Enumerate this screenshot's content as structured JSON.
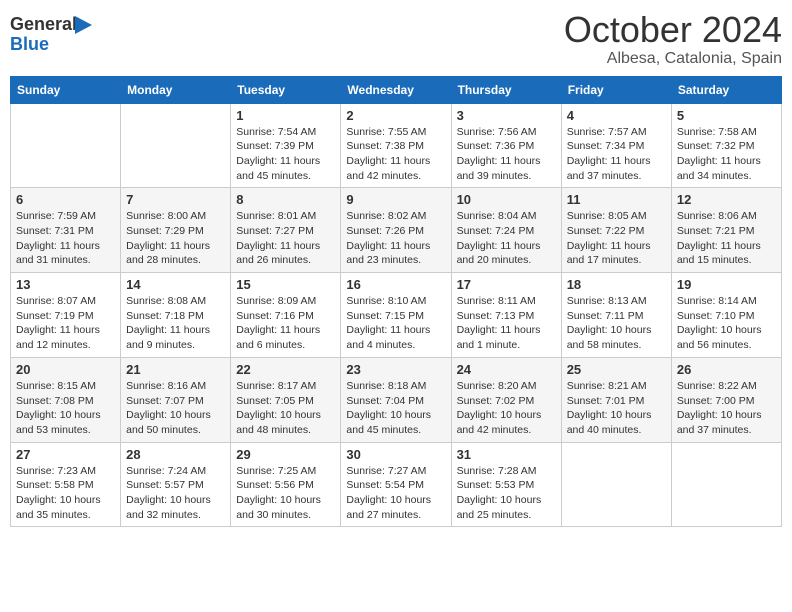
{
  "header": {
    "logo_general": "General",
    "logo_blue": "Blue",
    "month_title": "October 2024",
    "subtitle": "Albesa, Catalonia, Spain"
  },
  "weekdays": [
    "Sunday",
    "Monday",
    "Tuesday",
    "Wednesday",
    "Thursday",
    "Friday",
    "Saturday"
  ],
  "weeks": [
    [
      {
        "day": "",
        "sunrise": "",
        "sunset": "",
        "daylight": ""
      },
      {
        "day": "",
        "sunrise": "",
        "sunset": "",
        "daylight": ""
      },
      {
        "day": "1",
        "sunrise": "Sunrise: 7:54 AM",
        "sunset": "Sunset: 7:39 PM",
        "daylight": "Daylight: 11 hours and 45 minutes."
      },
      {
        "day": "2",
        "sunrise": "Sunrise: 7:55 AM",
        "sunset": "Sunset: 7:38 PM",
        "daylight": "Daylight: 11 hours and 42 minutes."
      },
      {
        "day": "3",
        "sunrise": "Sunrise: 7:56 AM",
        "sunset": "Sunset: 7:36 PM",
        "daylight": "Daylight: 11 hours and 39 minutes."
      },
      {
        "day": "4",
        "sunrise": "Sunrise: 7:57 AM",
        "sunset": "Sunset: 7:34 PM",
        "daylight": "Daylight: 11 hours and 37 minutes."
      },
      {
        "day": "5",
        "sunrise": "Sunrise: 7:58 AM",
        "sunset": "Sunset: 7:32 PM",
        "daylight": "Daylight: 11 hours and 34 minutes."
      }
    ],
    [
      {
        "day": "6",
        "sunrise": "Sunrise: 7:59 AM",
        "sunset": "Sunset: 7:31 PM",
        "daylight": "Daylight: 11 hours and 31 minutes."
      },
      {
        "day": "7",
        "sunrise": "Sunrise: 8:00 AM",
        "sunset": "Sunset: 7:29 PM",
        "daylight": "Daylight: 11 hours and 28 minutes."
      },
      {
        "day": "8",
        "sunrise": "Sunrise: 8:01 AM",
        "sunset": "Sunset: 7:27 PM",
        "daylight": "Daylight: 11 hours and 26 minutes."
      },
      {
        "day": "9",
        "sunrise": "Sunrise: 8:02 AM",
        "sunset": "Sunset: 7:26 PM",
        "daylight": "Daylight: 11 hours and 23 minutes."
      },
      {
        "day": "10",
        "sunrise": "Sunrise: 8:04 AM",
        "sunset": "Sunset: 7:24 PM",
        "daylight": "Daylight: 11 hours and 20 minutes."
      },
      {
        "day": "11",
        "sunrise": "Sunrise: 8:05 AM",
        "sunset": "Sunset: 7:22 PM",
        "daylight": "Daylight: 11 hours and 17 minutes."
      },
      {
        "day": "12",
        "sunrise": "Sunrise: 8:06 AM",
        "sunset": "Sunset: 7:21 PM",
        "daylight": "Daylight: 11 hours and 15 minutes."
      }
    ],
    [
      {
        "day": "13",
        "sunrise": "Sunrise: 8:07 AM",
        "sunset": "Sunset: 7:19 PM",
        "daylight": "Daylight: 11 hours and 12 minutes."
      },
      {
        "day": "14",
        "sunrise": "Sunrise: 8:08 AM",
        "sunset": "Sunset: 7:18 PM",
        "daylight": "Daylight: 11 hours and 9 minutes."
      },
      {
        "day": "15",
        "sunrise": "Sunrise: 8:09 AM",
        "sunset": "Sunset: 7:16 PM",
        "daylight": "Daylight: 11 hours and 6 minutes."
      },
      {
        "day": "16",
        "sunrise": "Sunrise: 8:10 AM",
        "sunset": "Sunset: 7:15 PM",
        "daylight": "Daylight: 11 hours and 4 minutes."
      },
      {
        "day": "17",
        "sunrise": "Sunrise: 8:11 AM",
        "sunset": "Sunset: 7:13 PM",
        "daylight": "Daylight: 11 hours and 1 minute."
      },
      {
        "day": "18",
        "sunrise": "Sunrise: 8:13 AM",
        "sunset": "Sunset: 7:11 PM",
        "daylight": "Daylight: 10 hours and 58 minutes."
      },
      {
        "day": "19",
        "sunrise": "Sunrise: 8:14 AM",
        "sunset": "Sunset: 7:10 PM",
        "daylight": "Daylight: 10 hours and 56 minutes."
      }
    ],
    [
      {
        "day": "20",
        "sunrise": "Sunrise: 8:15 AM",
        "sunset": "Sunset: 7:08 PM",
        "daylight": "Daylight: 10 hours and 53 minutes."
      },
      {
        "day": "21",
        "sunrise": "Sunrise: 8:16 AM",
        "sunset": "Sunset: 7:07 PM",
        "daylight": "Daylight: 10 hours and 50 minutes."
      },
      {
        "day": "22",
        "sunrise": "Sunrise: 8:17 AM",
        "sunset": "Sunset: 7:05 PM",
        "daylight": "Daylight: 10 hours and 48 minutes."
      },
      {
        "day": "23",
        "sunrise": "Sunrise: 8:18 AM",
        "sunset": "Sunset: 7:04 PM",
        "daylight": "Daylight: 10 hours and 45 minutes."
      },
      {
        "day": "24",
        "sunrise": "Sunrise: 8:20 AM",
        "sunset": "Sunset: 7:02 PM",
        "daylight": "Daylight: 10 hours and 42 minutes."
      },
      {
        "day": "25",
        "sunrise": "Sunrise: 8:21 AM",
        "sunset": "Sunset: 7:01 PM",
        "daylight": "Daylight: 10 hours and 40 minutes."
      },
      {
        "day": "26",
        "sunrise": "Sunrise: 8:22 AM",
        "sunset": "Sunset: 7:00 PM",
        "daylight": "Daylight: 10 hours and 37 minutes."
      }
    ],
    [
      {
        "day": "27",
        "sunrise": "Sunrise: 7:23 AM",
        "sunset": "Sunset: 5:58 PM",
        "daylight": "Daylight: 10 hours and 35 minutes."
      },
      {
        "day": "28",
        "sunrise": "Sunrise: 7:24 AM",
        "sunset": "Sunset: 5:57 PM",
        "daylight": "Daylight: 10 hours and 32 minutes."
      },
      {
        "day": "29",
        "sunrise": "Sunrise: 7:25 AM",
        "sunset": "Sunset: 5:56 PM",
        "daylight": "Daylight: 10 hours and 30 minutes."
      },
      {
        "day": "30",
        "sunrise": "Sunrise: 7:27 AM",
        "sunset": "Sunset: 5:54 PM",
        "daylight": "Daylight: 10 hours and 27 minutes."
      },
      {
        "day": "31",
        "sunrise": "Sunrise: 7:28 AM",
        "sunset": "Sunset: 5:53 PM",
        "daylight": "Daylight: 10 hours and 25 minutes."
      },
      {
        "day": "",
        "sunrise": "",
        "sunset": "",
        "daylight": ""
      },
      {
        "day": "",
        "sunrise": "",
        "sunset": "",
        "daylight": ""
      }
    ]
  ]
}
